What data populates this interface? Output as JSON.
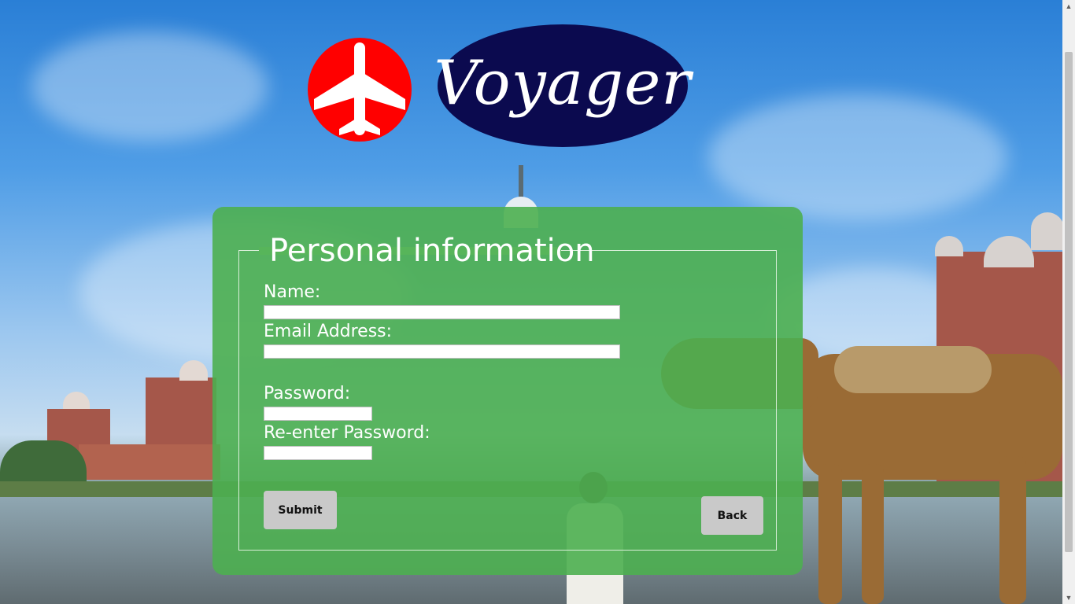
{
  "brand": {
    "name": "Voyager"
  },
  "icons": {
    "logo": "airplane-icon",
    "scroll_up": "triangle-up-icon",
    "scroll_down": "triangle-down-icon"
  },
  "form": {
    "legend": "Personal information",
    "name_label": "Name:",
    "email_label": "Email Address:",
    "password_label": "Password:",
    "reenter_label": "Re-enter Password:",
    "name_value": "",
    "email_value": "",
    "password_value": "",
    "reenter_value": "",
    "submit_label": "Submit",
    "back_label": "Back"
  },
  "colors": {
    "panel": "#4caf50",
    "logo_red": "#ff0000",
    "brand_navy": "#0b0a4f"
  }
}
